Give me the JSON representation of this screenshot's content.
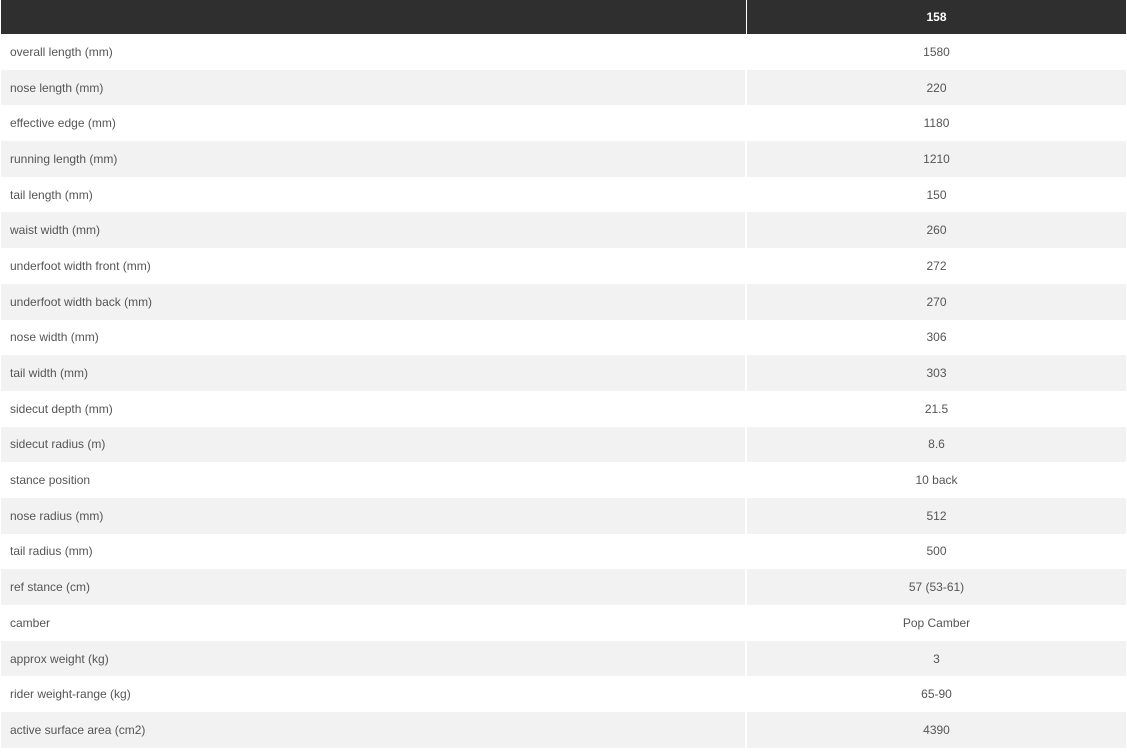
{
  "header": {
    "size": "158"
  },
  "rows": [
    {
      "label": "overall length (mm)",
      "value": "1580"
    },
    {
      "label": "nose length (mm)",
      "value": "220"
    },
    {
      "label": "effective edge (mm)",
      "value": "1180"
    },
    {
      "label": "running length (mm)",
      "value": "1210"
    },
    {
      "label": "tail length (mm)",
      "value": "150"
    },
    {
      "label": "waist width (mm)",
      "value": "260"
    },
    {
      "label": "underfoot width front (mm)",
      "value": "272"
    },
    {
      "label": "underfoot width back (mm)",
      "value": "270"
    },
    {
      "label": "nose width (mm)",
      "value": "306"
    },
    {
      "label": "tail width (mm)",
      "value": "303"
    },
    {
      "label": "sidecut depth (mm)",
      "value": "21.5"
    },
    {
      "label": "sidecut radius (m)",
      "value": "8.6"
    },
    {
      "label": "stance position",
      "value": "10 back"
    },
    {
      "label": "nose radius (mm)",
      "value": "512"
    },
    {
      "label": "tail radius (mm)",
      "value": "500"
    },
    {
      "label": "ref stance (cm)",
      "value": "57 (53-61)"
    },
    {
      "label": "camber",
      "value": "Pop Camber"
    },
    {
      "label": "approx weight (kg)",
      "value": "3"
    },
    {
      "label": "rider weight-range (kg)",
      "value": "65-90"
    },
    {
      "label": "active surface area (cm2)",
      "value": "4390"
    }
  ]
}
